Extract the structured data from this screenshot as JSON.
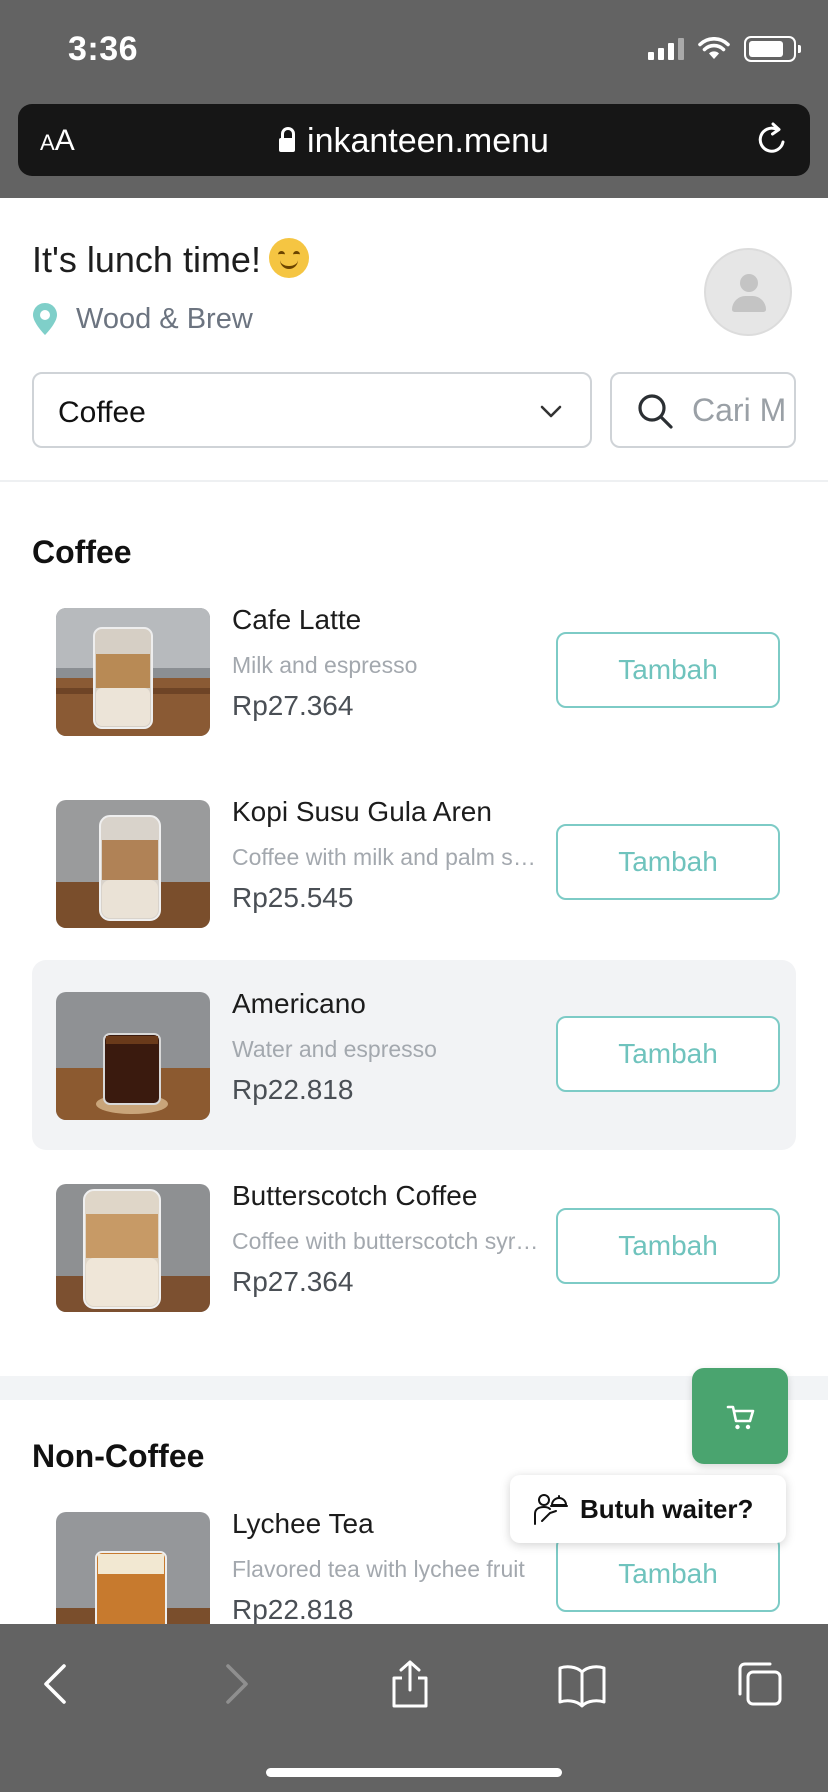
{
  "status_bar": {
    "time": "3:36"
  },
  "browser": {
    "text_size_label": "AA",
    "url": "inkanteen.menu"
  },
  "header": {
    "greeting": "It's lunch time!",
    "location": "Wood & Brew",
    "category_selected": "Coffee",
    "search_placeholder": "Cari Menu"
  },
  "sections": [
    {
      "title": "Coffee",
      "items": [
        {
          "name": "Cafe Latte",
          "description": "Milk and espresso",
          "price": "Rp27.364",
          "button": "Tambah"
        },
        {
          "name": "Kopi Susu Gula Aren",
          "description": "Coffee with milk and palm sugar",
          "price": "Rp25.545",
          "button": "Tambah"
        },
        {
          "name": "Americano",
          "description": "Water and espresso",
          "price": "Rp22.818",
          "button": "Tambah"
        },
        {
          "name": "Butterscotch Coffee",
          "description": "Coffee with butterscotch syrup",
          "price": "Rp27.364",
          "button": "Tambah"
        }
      ]
    },
    {
      "title": "Non-Coffee",
      "items": [
        {
          "name": "Lychee Tea",
          "description": "Flavored tea with lychee fruit",
          "price": "Rp22.818",
          "button": "Tambah"
        }
      ]
    }
  ],
  "floating": {
    "waiter_label": "Butuh waiter?"
  },
  "colors": {
    "accent": "#6fc3bd",
    "cart": "#4aa46f",
    "chrome": "#636363"
  }
}
